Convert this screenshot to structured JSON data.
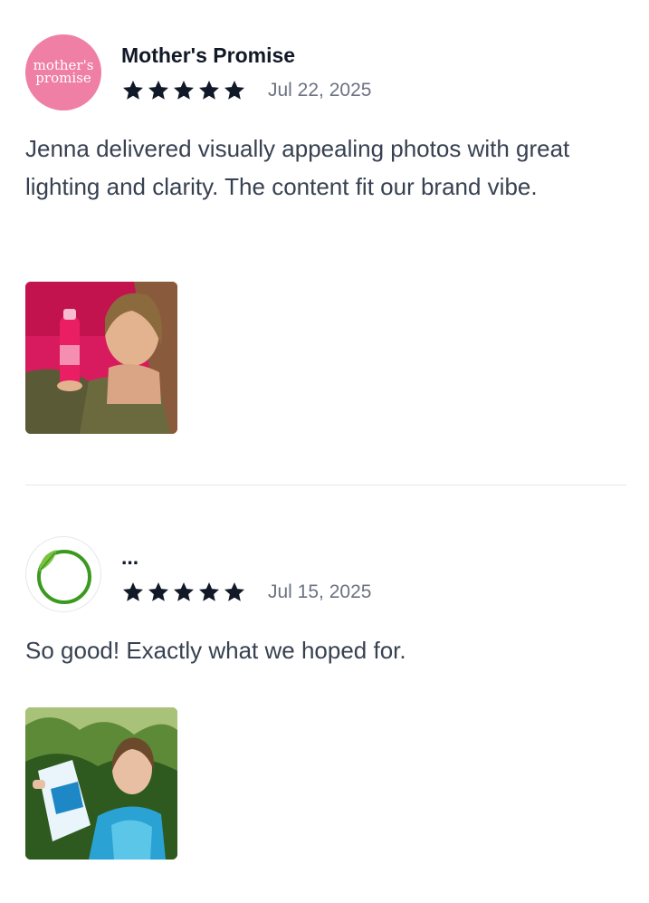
{
  "reviews": [
    {
      "author": "Mother's Promise",
      "avatar": {
        "type": "brand-logo",
        "logo_line1": "mother's",
        "logo_line2": "promise",
        "background": "#f07fa6"
      },
      "rating": 5,
      "rating_max": 5,
      "date": "Jul 22, 2025",
      "text": "Jenna delivered visually appealing photos with great lighting and clarity. The content fit our brand vibe.",
      "photo": "pink-bottle-selfie-photo"
    },
    {
      "author": "...",
      "avatar": {
        "type": "brand-logo",
        "icon": "green-leaf-ring-icon",
        "accent": "#3a9a1f"
      },
      "rating": 5,
      "rating_max": 5,
      "date": "Jul 15, 2025",
      "text": "So good! Exactly what we hoped for.",
      "photo": "collagen-bag-garden-photo"
    }
  ],
  "colors": {
    "star": "#111827",
    "text": "#374151",
    "muted": "#6b7280",
    "divider": "#e5e7eb"
  }
}
